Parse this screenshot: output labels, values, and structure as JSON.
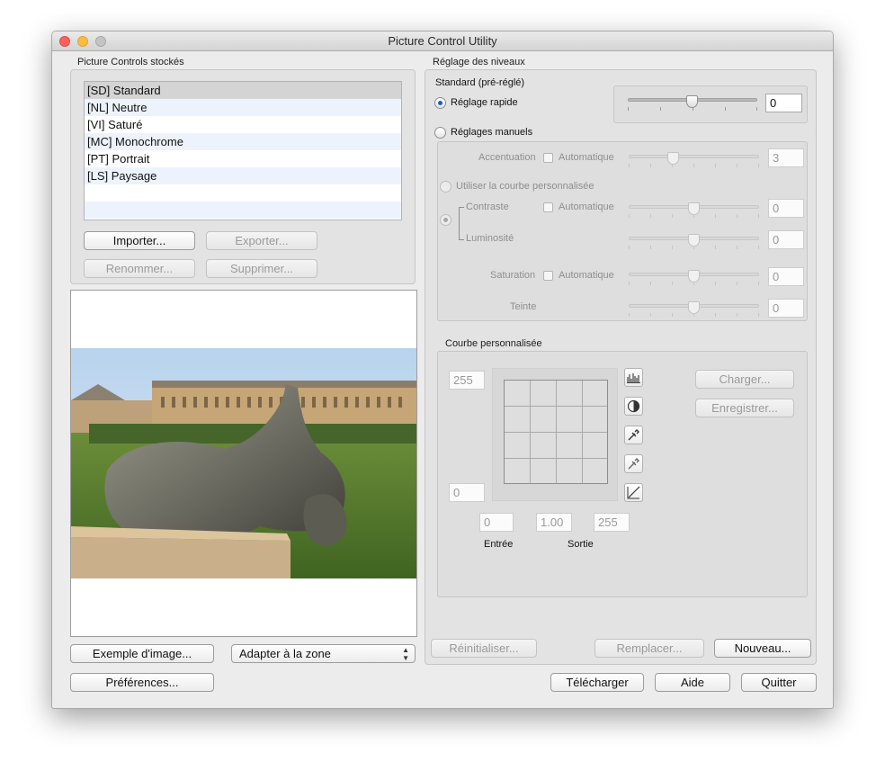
{
  "window": {
    "title": "Picture Control Utility"
  },
  "stored": {
    "title": "Picture Controls stockés",
    "items": [
      "[SD] Standard",
      "[NL] Neutre",
      "[VI] Saturé",
      "[MC] Monochrome",
      "[PT] Portrait",
      "[LS] Paysage"
    ],
    "selected_index": 0,
    "import_label": "Importer...",
    "export_label": "Exporter...",
    "rename_label": "Renommer...",
    "delete_label": "Supprimer..."
  },
  "preview": {
    "sample_label": "Exemple d'image...",
    "fit_select": "Adapter à la zone",
    "prefs_label": "Préférences..."
  },
  "levels": {
    "title": "Réglage des niveaux",
    "preset_name": "Standard (pré-réglé)",
    "quick_label": "Réglage rapide",
    "quick_value": "0",
    "quick_level": 0.5,
    "manual_label": "Réglages manuels",
    "sharpening": {
      "label": "Accentuation",
      "auto": "Automatique",
      "value": "3",
      "level": 0.33
    },
    "custom_curve_label": "Utiliser la courbe personnalisée",
    "contrast": {
      "label": "Contraste",
      "auto": "Automatique",
      "value": "0",
      "level": 0.5
    },
    "brightness": {
      "label": "Luminosité",
      "value": "0",
      "level": 0.5
    },
    "saturation": {
      "label": "Saturation",
      "auto": "Automatique",
      "value": "0",
      "level": 0.5
    },
    "hue": {
      "label": "Teinte",
      "value": "0",
      "level": 0.5
    }
  },
  "curve": {
    "title": "Courbe personnalisée",
    "out_max": "255",
    "out_min": "0",
    "input_min": "0",
    "gamma": "1.00",
    "input_max": "255",
    "entry_label": "Entrée",
    "output_label": "Sortie",
    "load_label": "Charger...",
    "save_label": "Enregistrer..."
  },
  "actions": {
    "reset_label": "Réinitialiser...",
    "replace_label": "Remplacer...",
    "new_label": "Nouveau...",
    "download_label": "Télécharger",
    "help_label": "Aide",
    "quit_label": "Quitter"
  },
  "colors": {
    "accent": "#1d5ad1",
    "close": "#fc605c",
    "minimize": "#fdbc40",
    "zoom": "#c4c4c4"
  }
}
